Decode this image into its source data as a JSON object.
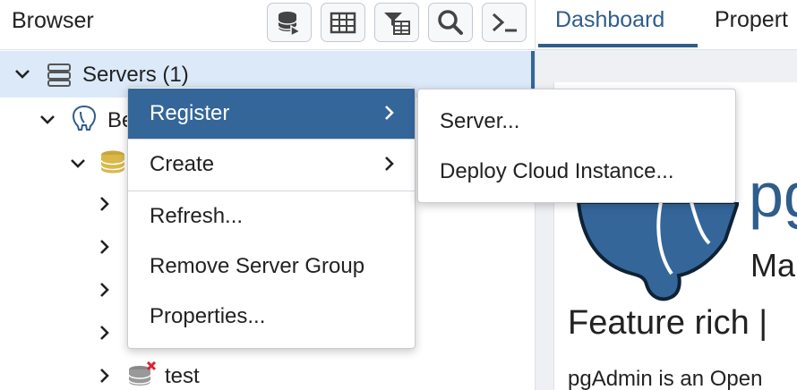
{
  "browser": {
    "title": "Browser",
    "toolbar": {
      "buttons": [
        {
          "name": "query-tool-button",
          "icon": "database-query-icon"
        },
        {
          "name": "view-data-button",
          "icon": "table-icon"
        },
        {
          "name": "filtered-rows-button",
          "icon": "filter-table-icon"
        },
        {
          "name": "search-objects-button",
          "icon": "search-icon"
        },
        {
          "name": "psql-tool-button",
          "icon": "terminal-icon"
        }
      ]
    },
    "tree": {
      "servers_label": "Servers (1)",
      "server_label_partial": "Be",
      "test_label": "test"
    }
  },
  "tabs": {
    "dashboard": "Dashboard",
    "properties": "Propert"
  },
  "dashboard": {
    "logo_text": "pg",
    "subtitle_partial": "Ma",
    "feature_text": "Feature rich |",
    "intro_text": "pgAdmin is an Open"
  },
  "context_menu": {
    "items": [
      {
        "label": "Register",
        "has_submenu": true
      },
      {
        "label": "Create",
        "has_submenu": true
      },
      {
        "label": "Refresh..."
      },
      {
        "label": "Remove Server Group"
      },
      {
        "label": "Properties..."
      }
    ]
  },
  "sub_menu": {
    "items": [
      {
        "label": "Server..."
      },
      {
        "label": "Deploy Cloud Instance..."
      }
    ]
  },
  "colors": {
    "accent": "#34669a",
    "selected_row": "#dbe9f8",
    "logo_blue": "#2f5d8c"
  }
}
